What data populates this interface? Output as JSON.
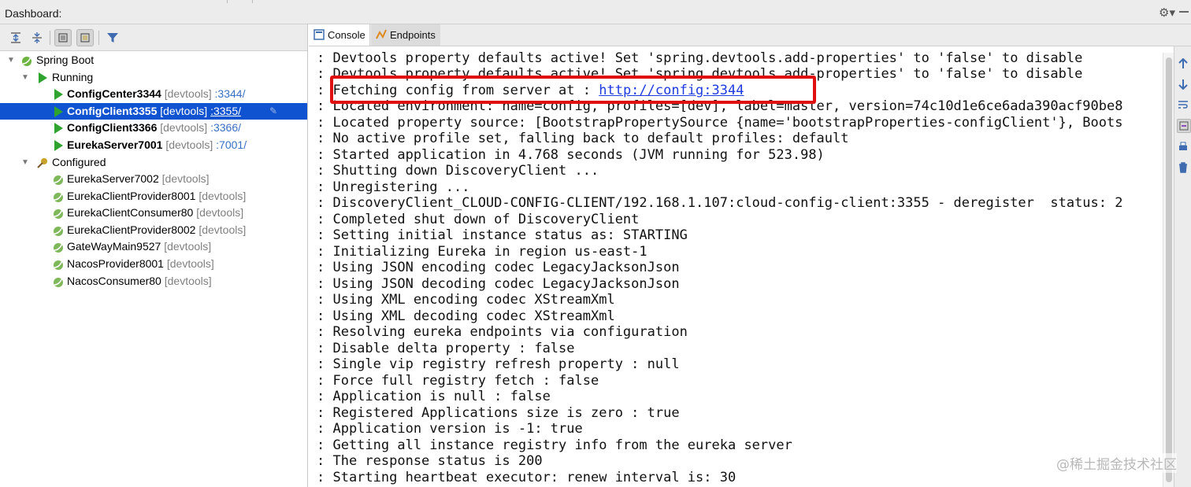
{
  "window": {
    "title": "Dashboard:"
  },
  "left": {
    "tree": {
      "spring_boot": "Spring Boot",
      "running": "Running",
      "configured": "Configured",
      "running_items": [
        {
          "name": "ConfigCenter3344",
          "tag": "[devtools]",
          "port": ":3344/"
        },
        {
          "name": "ConfigClient3355",
          "tag": "[devtools]",
          "port": ":3355/"
        },
        {
          "name": "ConfigClient3366",
          "tag": "[devtools]",
          "port": ":3366/"
        },
        {
          "name": "EurekaServer7001",
          "tag": "[devtools]",
          "port": ":7001/"
        }
      ],
      "configured_items": [
        {
          "name": "EurekaServer7002",
          "tag": "[devtools]"
        },
        {
          "name": "EurekaClientProvider8001",
          "tag": "[devtools]"
        },
        {
          "name": "EurekaClientConsumer80",
          "tag": "[devtools]"
        },
        {
          "name": "EurekaClientProvider8002",
          "tag": "[devtools]"
        },
        {
          "name": "GateWayMain9527",
          "tag": "[devtools]"
        },
        {
          "name": "NacosProvider8001",
          "tag": "[devtools]"
        },
        {
          "name": "NacosConsumer80",
          "tag": "[devtools]"
        }
      ]
    }
  },
  "right": {
    "tabs": [
      {
        "label": "Console"
      },
      {
        "label": "Endpoints"
      }
    ],
    "console": {
      "lines": [
        ": Devtools property defaults active! Set 'spring.devtools.add-properties' to 'false' to disable",
        ": Devtools property defaults active! Set 'spring.devtools.add-properties' to 'false' to disable",
        ": Fetching config from server at : ",
        ": Located environment: name=config, profiles=[dev], label=master, version=74c10d1e6ce6ada390acf90be8",
        ": Located property source: [BootstrapPropertySource {name='bootstrapProperties-configClient'}, Boots",
        ": No active profile set, falling back to default profiles: default",
        ": Started application in 4.768 seconds (JVM running for 523.98)",
        ": Shutting down DiscoveryClient ...",
        ": Unregistering ...",
        ": DiscoveryClient_CLOUD-CONFIG-CLIENT/192.168.1.107:cloud-config-client:3355 - deregister  status: 2",
        ": Completed shut down of DiscoveryClient",
        ": Setting initial instance status as: STARTING",
        ": Initializing Eureka in region us-east-1",
        ": Using JSON encoding codec LegacyJacksonJson",
        ": Using JSON decoding codec LegacyJacksonJson",
        ": Using XML encoding codec XStreamXml",
        ": Using XML decoding codec XStreamXml",
        ": Resolving eureka endpoints via configuration",
        ": Disable delta property : false",
        ": Single vip registry refresh property : null",
        ": Force full registry fetch : false",
        ": Application is null : false",
        ": Registered Applications size is zero : true",
        ": Application version is -1: true",
        ": Getting all instance registry info from the eureka server",
        ": The response status is 200",
        ": Starting heartbeat executor: renew interval is: 30"
      ],
      "link": "http://config:3344"
    }
  },
  "watermark": "@稀土掘金技术社区",
  "colors": {
    "selection": "#0f53d0",
    "highlight_box": "#e01010",
    "link": "#1e3be0",
    "run_icon": "#2ea42e"
  }
}
